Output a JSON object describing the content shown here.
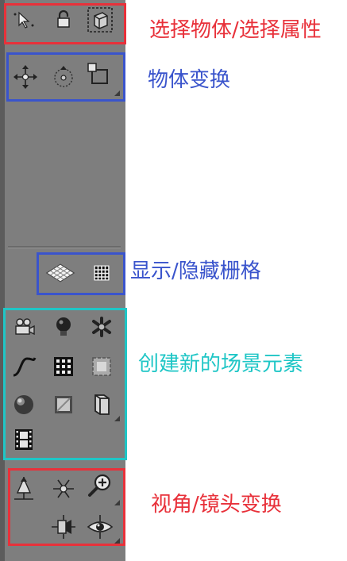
{
  "toolbar": {
    "icons": {
      "select": "select-arrow-icon",
      "lock": "lock-icon",
      "select_region": "select-region-icon",
      "move": "move-arrows-icon",
      "rotate": "rotate-icon",
      "scale": "scale-icon",
      "grid_plane": "grid-plane-icon",
      "grid_toggle": "grid-toggle-icon",
      "camera": "camera-icon",
      "light": "light-bulb-icon",
      "skeleton": "bone-icon",
      "curve": "curve-icon",
      "particles": "particle-grid-icon",
      "plane_frame": "plane-frame-icon",
      "sphere": "sphere-icon",
      "box_primitive": "box-primitive-icon",
      "cylinder": "cylinder-icon",
      "film": "film-icon",
      "view_up": "view-up-icon",
      "view_orbit": "view-orbit-icon",
      "zoom": "zoom-icon",
      "view_dolly": "view-dolly-icon",
      "view_eye": "view-eye-icon"
    }
  },
  "annotations": {
    "select": {
      "text": "选择物体/选择属性",
      "color": "#e8313a"
    },
    "transform": {
      "text": "物体变换",
      "color": "#3a54cc"
    },
    "grid": {
      "text": "显示/隐藏栅格",
      "color": "#3a54cc"
    },
    "create": {
      "text": "创建新的场景元素",
      "color": "#1fc6c6"
    },
    "view": {
      "text": "视角/镜头变换",
      "color": "#e8313a"
    }
  }
}
